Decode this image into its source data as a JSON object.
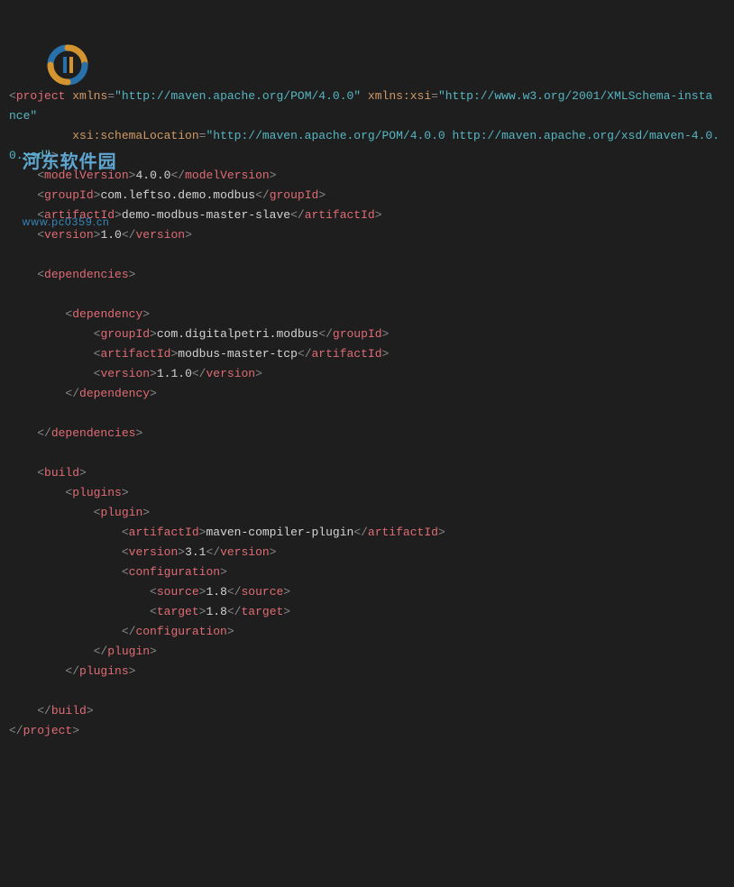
{
  "wm": {
    "title": "河东软件园",
    "url": "www.pc0359.cn"
  },
  "x": {
    "project": "project",
    "xmlns": "xmlns",
    "xmlnsVal": "\"http://maven.apache.org/POM/4.0.0\"",
    "xsiAttr": "xmlns:xsi",
    "xsiVal": "\"http://www.w3.org/2001/XMLSchema-insta",
    "nce": "nce\"",
    "schemaLoc": "xsi:schemaLocation",
    "schemaVal1": "\"http://maven.apache.org/POM/4.0.0 http://maven.apache.org/xsd/maven-4.0.",
    "schemaVal2": "0.xsd\"",
    "modelVersion": "modelVersion",
    "modelVersionV": "4.0.0",
    "groupId": "groupId",
    "groupIdV": "com.leftso.demo.modbus",
    "artifactId": "artifactId",
    "artifactIdV": "demo-modbus-master-slave",
    "version": "version",
    "versionV": "1.0",
    "dependencies": "dependencies",
    "dependency": "dependency",
    "depGroupIdV": "com.digitalpetri.modbus",
    "depArtifactIdV": "modbus-master-tcp",
    "depVersionV": "1.1.0",
    "build": "build",
    "plugins": "plugins",
    "plugin": "plugin",
    "plArtifactIdV": "maven-compiler-plugin",
    "plVersionV": "3.1",
    "configuration": "configuration",
    "source": "source",
    "sourceV": "1.8",
    "target": "target",
    "targetV": "1.8"
  }
}
